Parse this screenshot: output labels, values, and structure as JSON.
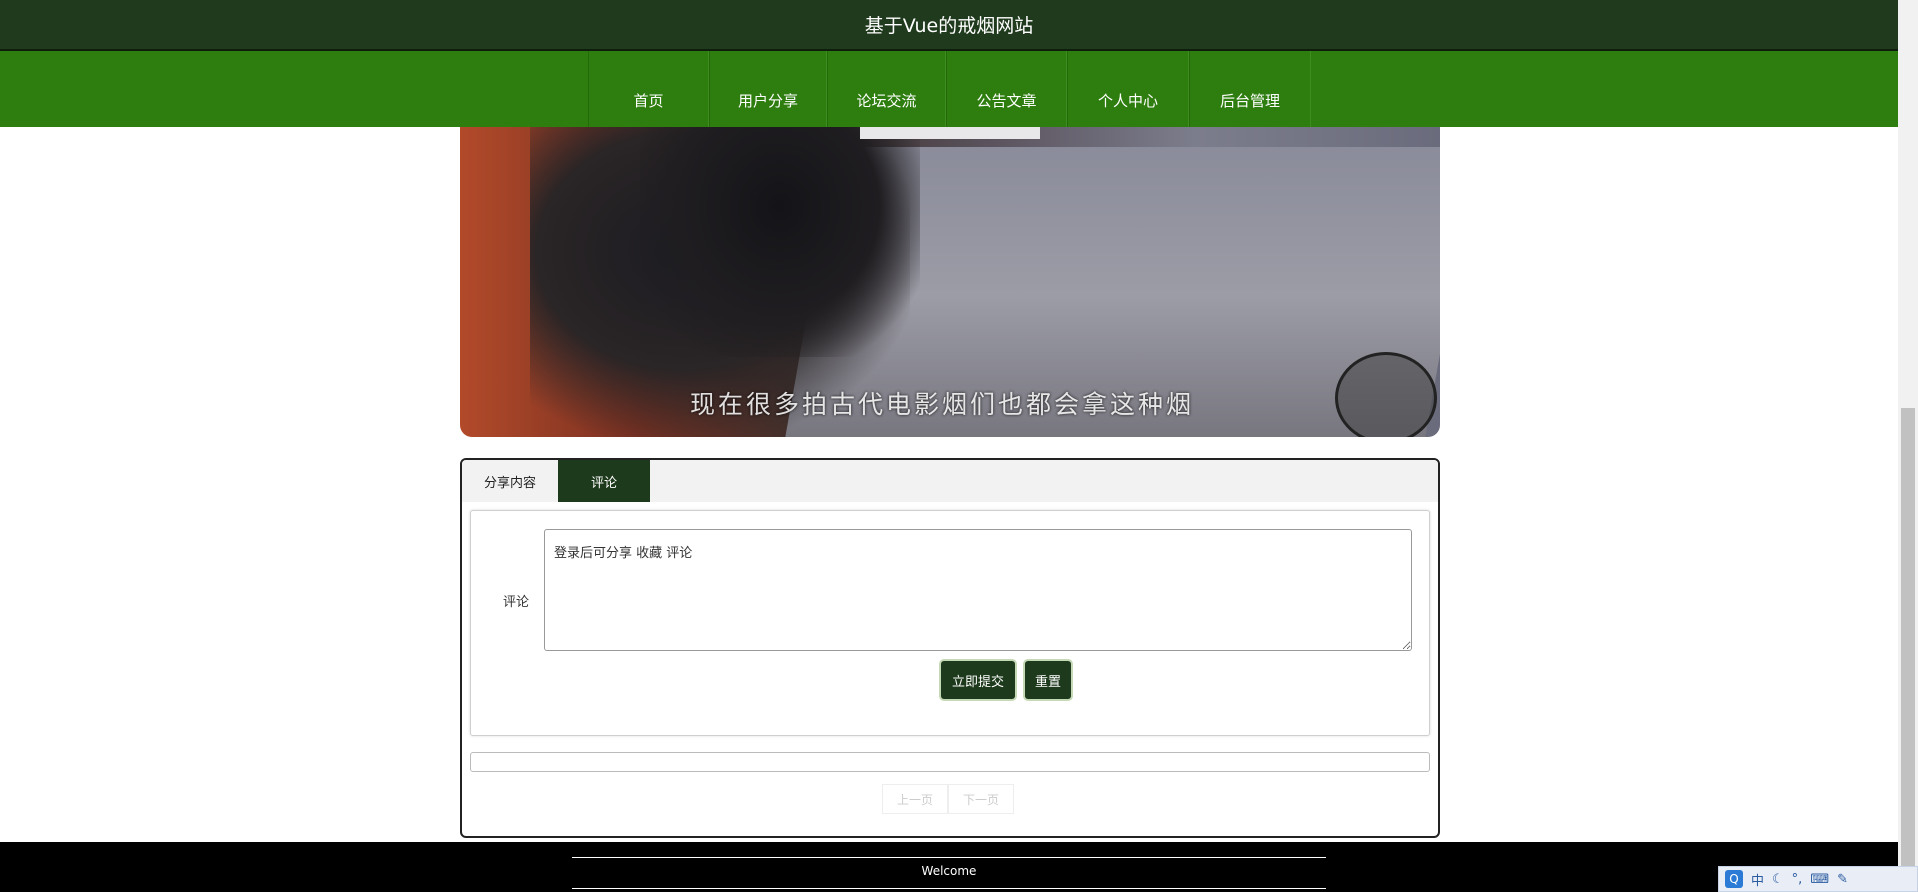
{
  "site": {
    "title": "基于Vue的戒烟网站"
  },
  "nav": {
    "items": [
      {
        "label": "首页"
      },
      {
        "label": "用户分享"
      },
      {
        "label": "论坛交流"
      },
      {
        "label": "公告文章"
      },
      {
        "label": "个人中心"
      },
      {
        "label": "后台管理"
      }
    ]
  },
  "banner": {
    "caption": "现在很多拍古代电影烟们也都会拿这种烟"
  },
  "tabs": [
    {
      "label": "分享内容",
      "active": false
    },
    {
      "label": "评论",
      "active": true
    }
  ],
  "comment_form": {
    "label": "评论",
    "placeholder": "登录后可分享 收藏 评论",
    "submit_label": "立即提交",
    "reset_label": "重置"
  },
  "pager": {
    "prev": "上一页",
    "next": "下一页"
  },
  "footer": {
    "text": "Welcome"
  },
  "ime": {
    "mode": "中",
    "icons": [
      "q-logo-icon",
      "moon-icon",
      "punctuation-icon",
      "keyboard-icon",
      "settings-icon"
    ]
  },
  "colors": {
    "header": "#1f3a1c",
    "nav": "#2e7d0f",
    "accent": "#1e3a1c"
  }
}
